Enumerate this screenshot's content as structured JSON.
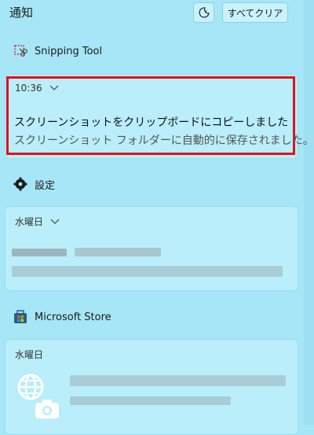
{
  "header": {
    "title": "通知",
    "clear_all_label": "すべてクリア"
  },
  "groups": {
    "snipping": {
      "app_name": "Snipping Tool",
      "notification": {
        "time": "10:36",
        "title": "スクリーンショットをクリップボードにコピーしました",
        "body": "スクリーンショット フォルダーに自動的に保存されました。"
      }
    },
    "settings": {
      "app_name": "設定",
      "notification": {
        "time": "水曜日"
      }
    },
    "store": {
      "app_name": "Microsoft Store",
      "notification": {
        "time": "水曜日"
      }
    }
  },
  "colors": {
    "highlight": "#e0121b",
    "background": "#a6e6f6"
  }
}
